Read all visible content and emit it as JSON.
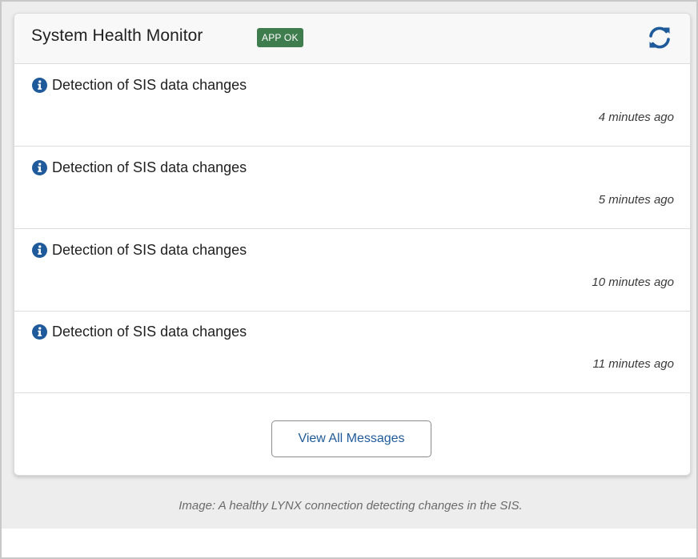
{
  "widget": {
    "title": "System Health Monitor",
    "status_badge": "APP OK",
    "status_color": "#3f7d4f",
    "refresh_icon": "refresh-icon",
    "accent_color": "#1f5a9a"
  },
  "messages": [
    {
      "icon": "info-icon",
      "text": "Detection of SIS data changes",
      "time": "4 minutes ago"
    },
    {
      "icon": "info-icon",
      "text": "Detection of SIS data changes",
      "time": "5 minutes ago"
    },
    {
      "icon": "info-icon",
      "text": "Detection of SIS data changes",
      "time": "10 minutes ago"
    },
    {
      "icon": "info-icon",
      "text": "Detection of SIS data changes",
      "time": "11 minutes ago"
    }
  ],
  "footer": {
    "view_all_label": "View All Messages"
  },
  "caption": "Image: A healthy LYNX connection detecting changes in the SIS."
}
